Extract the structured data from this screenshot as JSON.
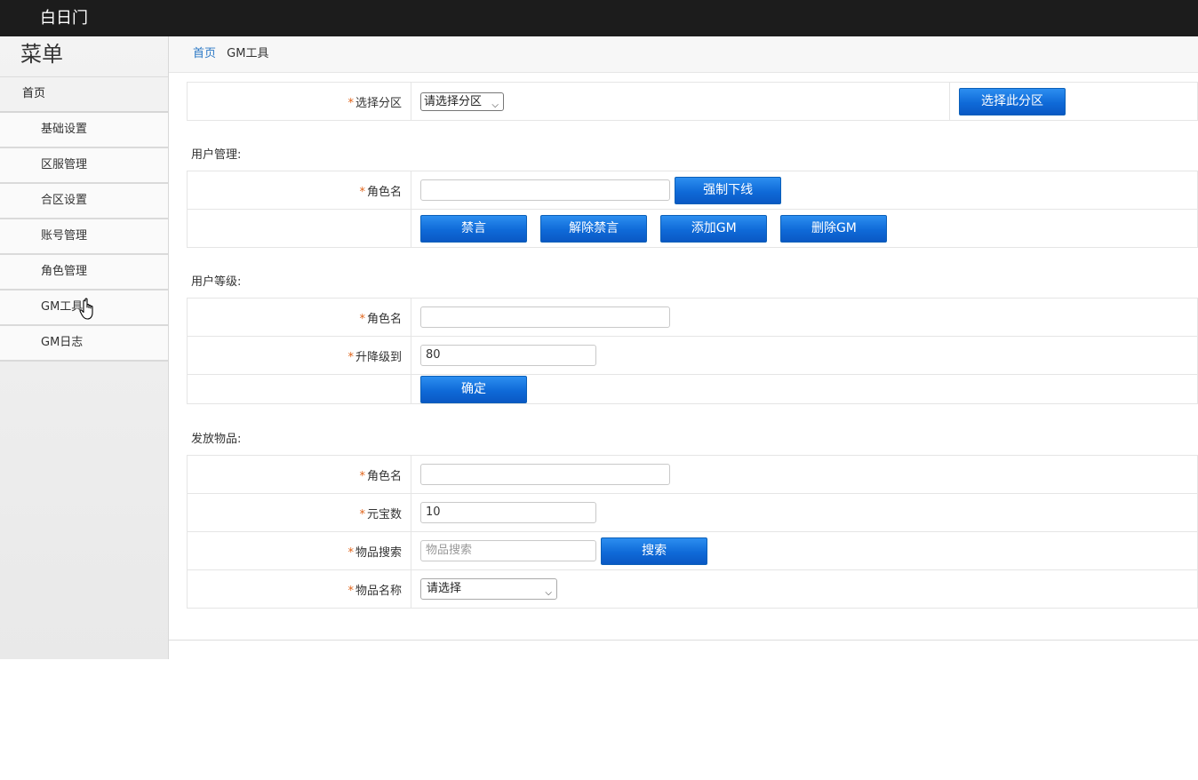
{
  "header": {
    "brand": "白日门"
  },
  "sidebar": {
    "title": "菜单",
    "home": "首页",
    "items": [
      {
        "label": "基础设置"
      },
      {
        "label": "区服管理"
      },
      {
        "label": "合区设置"
      },
      {
        "label": "账号管理"
      },
      {
        "label": "角色管理"
      },
      {
        "label": "GM工具"
      },
      {
        "label": "GM日志"
      }
    ]
  },
  "breadcrumb": {
    "home": "首页",
    "current": "GM工具"
  },
  "zone": {
    "label": "选择分区",
    "select_value": "请选择分区",
    "button": "选择此分区"
  },
  "user_manage": {
    "section": "用户管理:",
    "role_label": "角色名",
    "role_value": "",
    "kick_button": "强制下线",
    "mute_button": "禁言",
    "unmute_button": "解除禁言",
    "add_gm_button": "添加GM",
    "del_gm_button": "删除GM"
  },
  "user_level": {
    "section": "用户等级:",
    "role_label": "角色名",
    "role_value": "",
    "level_label": "升降级到",
    "level_value": "80",
    "confirm_button": "确定"
  },
  "items": {
    "section": "发放物品:",
    "role_label": "角色名",
    "role_value": "",
    "gold_label": "元宝数",
    "gold_value": "10",
    "search_label": "物品搜索",
    "search_placeholder": "物品搜索",
    "search_button": "搜索",
    "name_label": "物品名称",
    "name_select_value": "请选择"
  },
  "required_mark": "*"
}
